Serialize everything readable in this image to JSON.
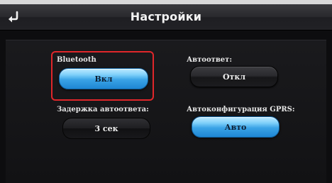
{
  "header": {
    "title": "Настройки",
    "back_icon": "back-arrow-icon"
  },
  "settings": {
    "bluetooth": {
      "label": "Bluetooth",
      "value": "Вкл"
    },
    "auto_answer": {
      "label": "Автоответ:",
      "value": "Откл"
    },
    "auto_answer_delay": {
      "label": "Задержка автоответа:",
      "value": "3 сек"
    },
    "gprs_autoconfig": {
      "label": "Автоконфигурация GPRS:",
      "value": "Авто"
    }
  },
  "colors": {
    "highlight": "#e0262a",
    "active_button": "#3aa3e6"
  }
}
